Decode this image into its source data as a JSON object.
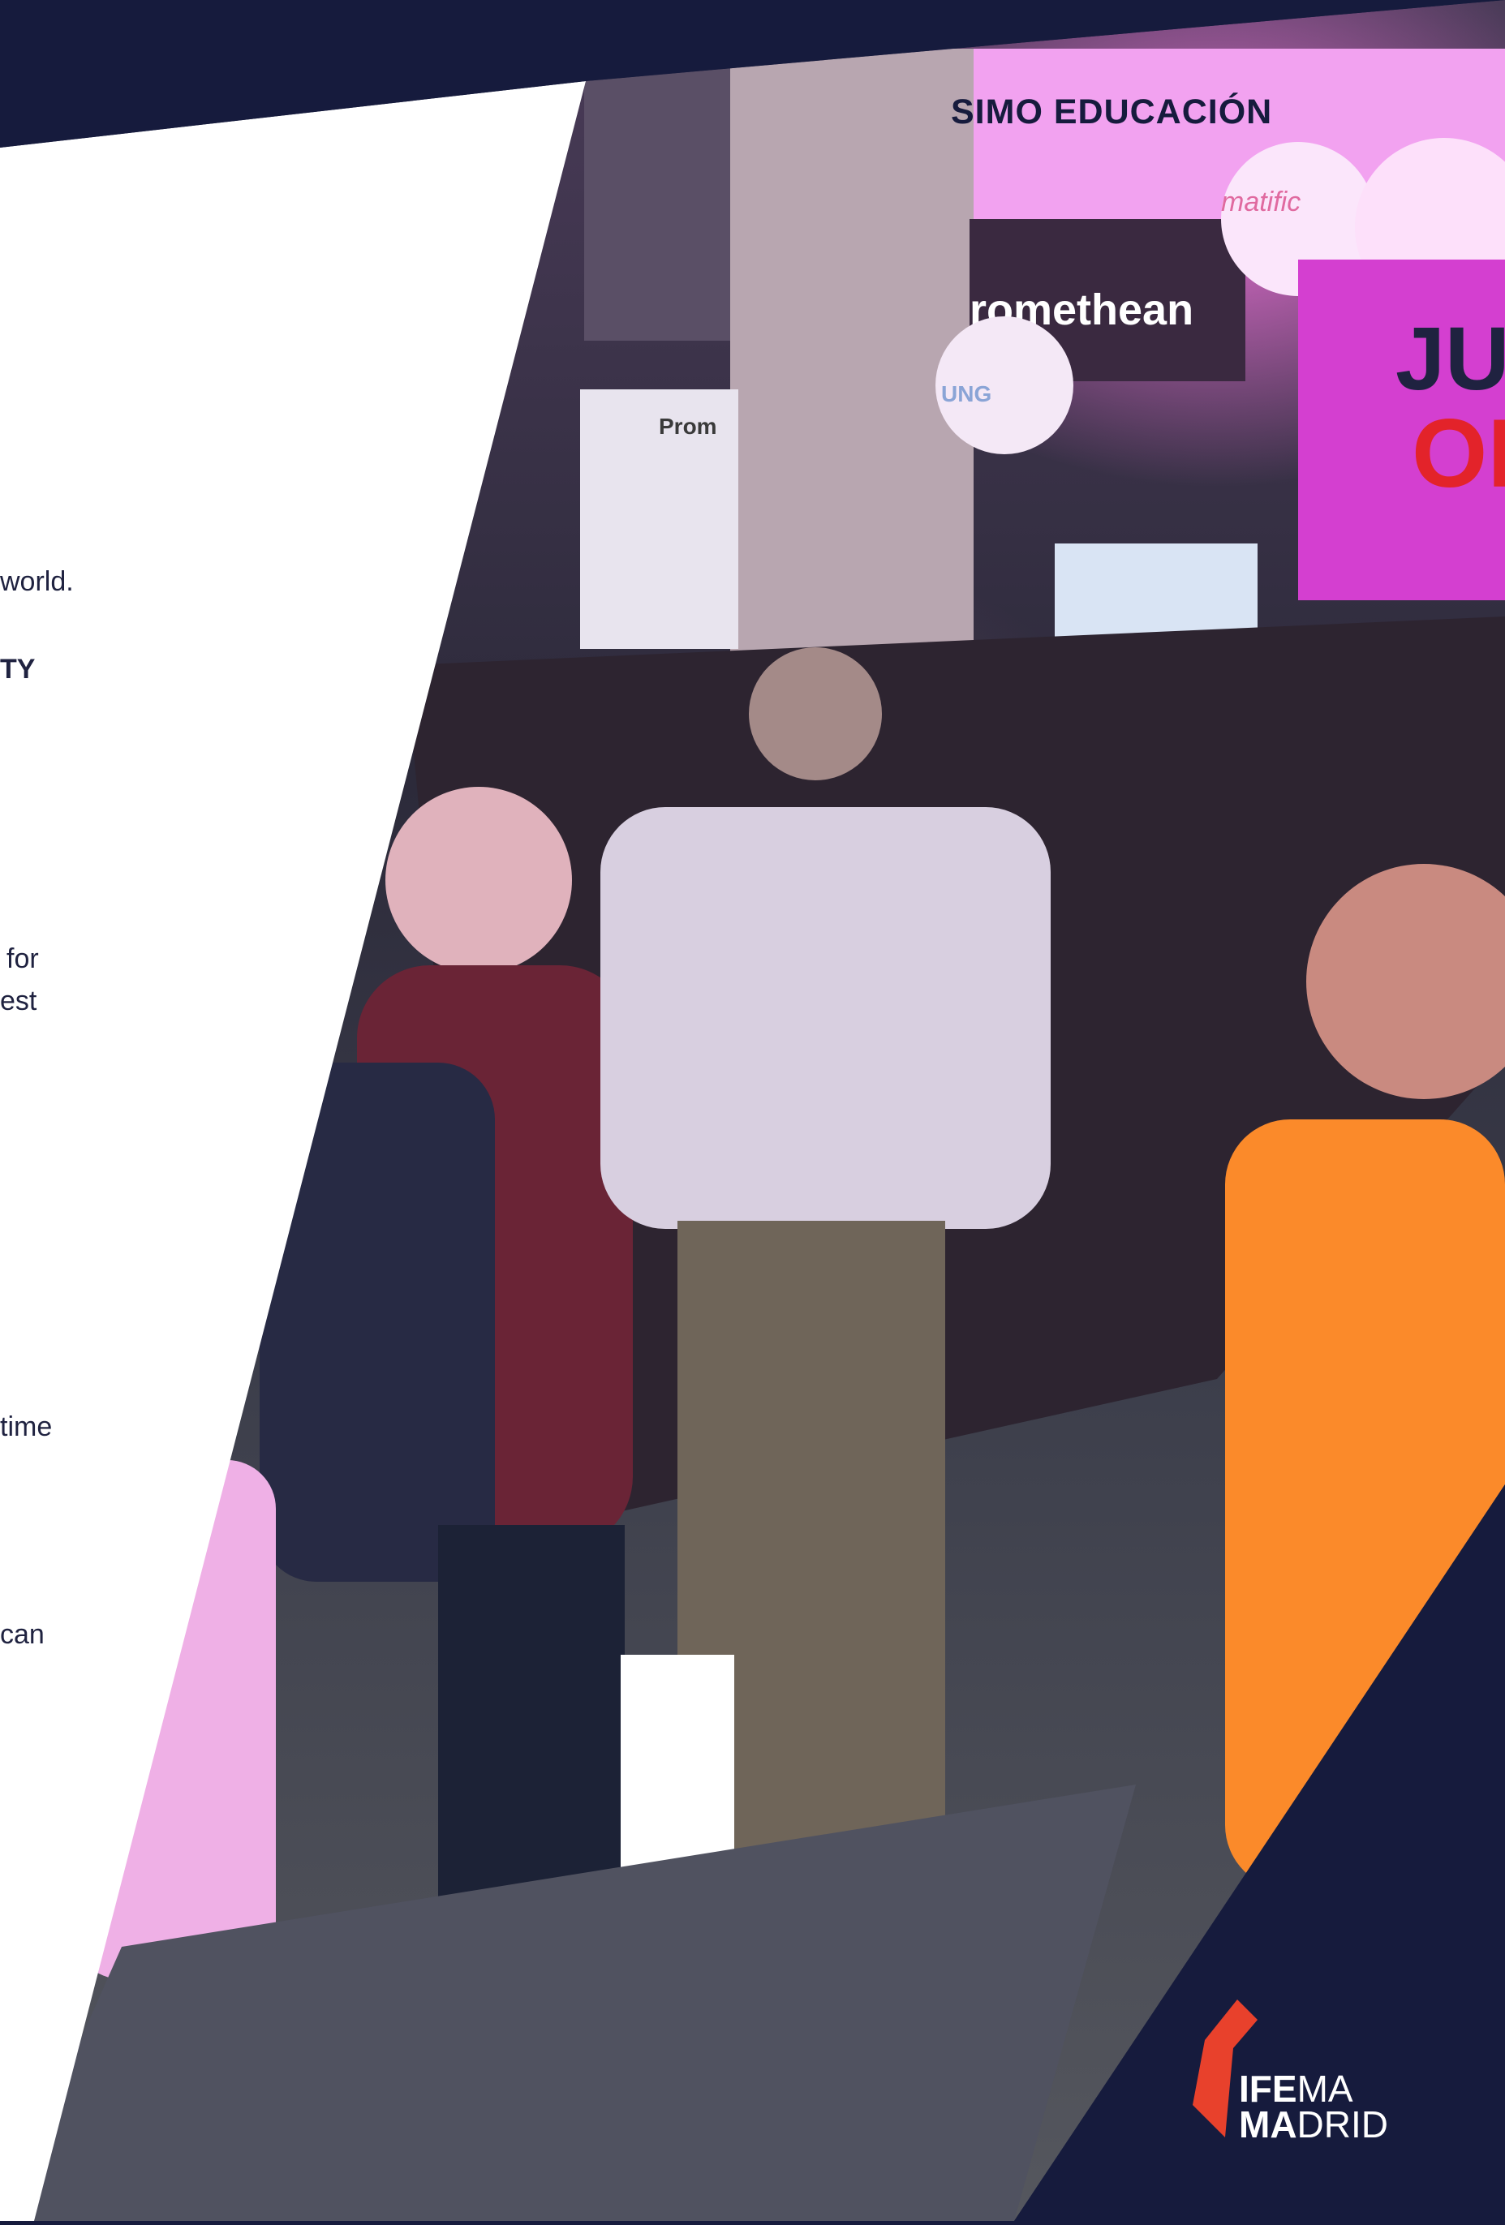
{
  "panel": {
    "fragments": [
      "world.",
      "TY",
      "for",
      "est",
      "time",
      "can"
    ]
  },
  "photo": {
    "event_tag": "SIMO EDUCACIÓN",
    "signs": {
      "promethean": "romethean",
      "promethean_small": "Prom",
      "balloon": "UNG",
      "slogan_line1": "JU",
      "slogan_line2": "OR",
      "matific": "matific"
    }
  },
  "logo": {
    "line1_bold": "IFE",
    "line1_regular": "MA",
    "line2_bold": "MA",
    "line2_regular": "DRID"
  },
  "colors": {
    "navy": "#161b3d",
    "logo_red": "#e8412c",
    "sign_red": "#e3232a",
    "magenta": "#ff7ae6"
  }
}
